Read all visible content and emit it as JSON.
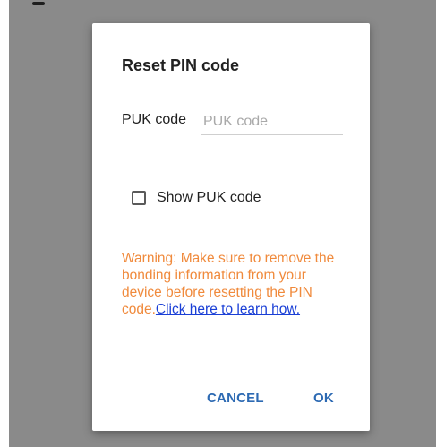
{
  "dialog": {
    "title": "Reset PIN code",
    "puk": {
      "label": "PUK code",
      "placeholder": "PUK code",
      "value": ""
    },
    "show_puk": {
      "label": "Show PUK code",
      "checked": false
    },
    "warning": {
      "text": "Warning: Make sure to remove the bonding information from your device before resetting the PIN code.",
      "link_text": "Click here to learn how."
    },
    "buttons": {
      "cancel": "CANCEL",
      "ok": "OK"
    }
  },
  "colors": {
    "scrim": "#8a8a8a",
    "warning": "#f08a3c",
    "link": "#1a3fd6",
    "button": "#2d6ab3"
  }
}
